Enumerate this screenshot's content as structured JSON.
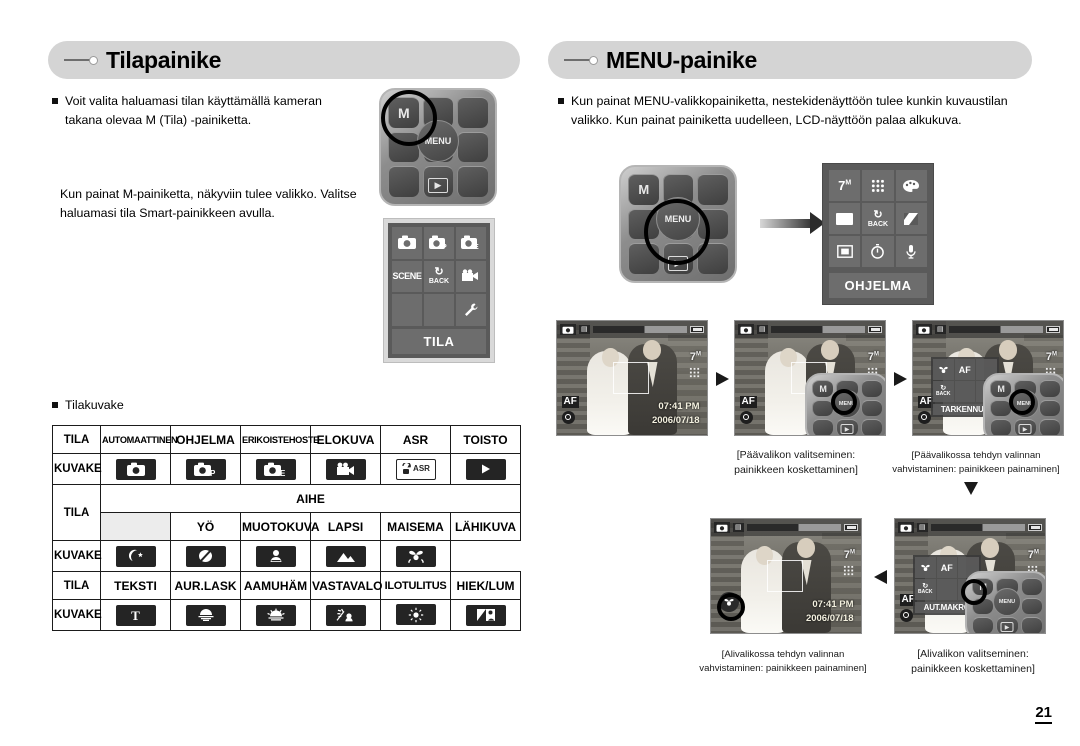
{
  "page": {
    "number": "21"
  },
  "left": {
    "header": "Tilapainike",
    "bullet1": "Voit valita haluamasi tilan käyttämällä kameran takana olevaa M (Tila) -painiketta.",
    "para2": "Kun painat M-painiketta, näkyviin tulee valikko. Valitse haluamasi tila Smart-painikkeen avulla.",
    "bullet2": "Tilakuvake",
    "buttonpad": {
      "m_label": "M",
      "menu_label": "MENU",
      "play_label": "▶"
    },
    "tila_menu": {
      "label": "TILA",
      "cells": [
        "camera-auto-icon",
        "camera-program-icon",
        "camera-effect-icon",
        "SCENE",
        "BACK",
        "movie-icon",
        "",
        "",
        "setup-wrench-icon"
      ],
      "back_label": "BACK",
      "scene_label": "SCENE"
    }
  },
  "right": {
    "header": "MENU-painike",
    "bullet1": "Kun painat MENU-valikkopainiketta, nestekidenäyttöön tulee kunkin kuvaustilan valikko. Kun painat painiketta uudelleen, LCD-näyttöön palaa alkukuva.",
    "buttonpad": {
      "m_label": "M",
      "menu_label": "MENU",
      "play_label": "▶"
    },
    "ohjelma_menu": {
      "label": "OHJELMA",
      "resolution": "7",
      "resolution_sup": "M",
      "back_label": "BACK",
      "cells": [
        "resolution-icon",
        "quality-dots-icon",
        "palette-icon",
        "white-balance-icon",
        "back-icon",
        "exposure-icon",
        "metering-icon",
        "timer-icon",
        "voice-icon"
      ]
    },
    "captions": {
      "top_left": "[Päävalikon valitseminen:\npainikkeen koskettaminen]",
      "top_left_l1": "[Päävalikon valitseminen:",
      "top_left_l2": "painikkeen koskettaminen]",
      "top_right_l1": "[Päävalikossa tehdyn valinnan",
      "top_right_l2": "vahvistaminen: painikkeen painaminen]",
      "bottom_left_l1": "[Alivalikossa tehdyn valinnan",
      "bottom_left_l2": "vahvistaminen: painikkeen painaminen]",
      "bottom_right_l1": "[Alivalikon valitseminen:",
      "bottom_right_l2": "painikkeen koskettaminen]"
    },
    "lcd": {
      "time": "07:41 PM",
      "date": "2006/07/18",
      "resolution": "7",
      "resolution_sup": "M",
      "af_label": "AF",
      "submenu_focus_label": "TARKENNUS",
      "submenu_macro_label": "AUT.MAKRO",
      "submenu_af": "AF",
      "submenu_back": "BACK"
    }
  },
  "table": {
    "row1": {
      "label": "TILA",
      "cells": [
        "AUTOMAATTINEN",
        "OHJELMA",
        "ERIKOISTEHOSTE",
        "ELOKUVA",
        "ASR",
        "TOISTO"
      ]
    },
    "row2": {
      "label": "KUVAKE",
      "icons": [
        "auto-camera-icon",
        "program-camera-icon",
        "effect-camera-icon",
        "movie-camera-icon",
        "asr-icon",
        "play-icon"
      ],
      "asr_text": "ASR"
    },
    "row3": {
      "label": "TILA",
      "group": "AIHE",
      "cells": [
        "YÖ",
        "MUOTOKUVA",
        "LAPSI",
        "MAISEMA",
        "LÄHIKUVA"
      ]
    },
    "row4": {
      "label": "KUVAKE",
      "icons": [
        "night-icon",
        "portrait-icon",
        "children-icon",
        "landscape-icon",
        "closeup-icon"
      ]
    },
    "row5": {
      "label": "TILA",
      "cells": [
        "TEKSTI",
        "AUR.LASK",
        "AAMUHÄM",
        "VASTAVALO",
        "ILOTULITUS",
        "HIEK/LUM"
      ]
    },
    "row6": {
      "label": "KUVAKE",
      "icons": [
        "text-icon",
        "sunset-icon",
        "dawn-icon",
        "backlight-icon",
        "fireworks-icon",
        "beachsnow-icon"
      ],
      "text_glyph": "T"
    }
  }
}
